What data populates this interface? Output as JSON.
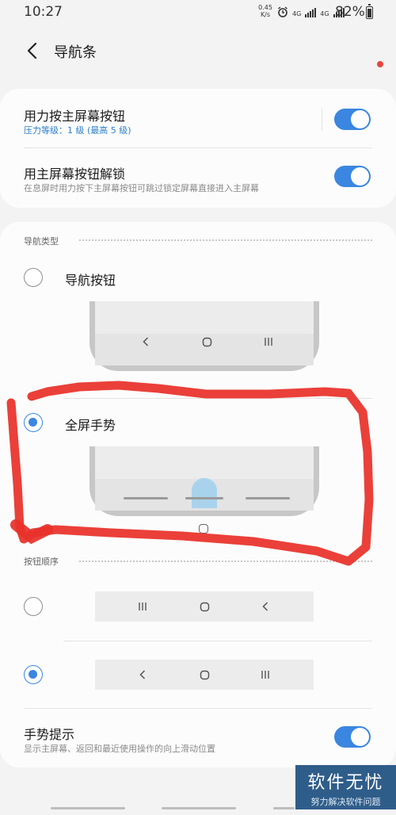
{
  "status": {
    "time": "10:27",
    "net_speed_value": "0.45",
    "net_speed_unit": "K/s",
    "net_type_1": "4G",
    "net_type_2": "4G",
    "battery_percent_text": "82%",
    "battery_level": 0.82
  },
  "header": {
    "title": "导航条",
    "notification_dot_color": "#e8453c"
  },
  "card1": {
    "row1": {
      "title": "用力按主屏幕按钮",
      "subtitle": "压力等级：1 级 (最高 5 级)",
      "toggle_on": true
    },
    "row2": {
      "title": "用主屏幕按钮解锁",
      "subtitle": "在息屏时用力按下主屏幕按钮可跳过锁定屏幕直接进入主屏幕",
      "toggle_on": true
    }
  },
  "nav_type": {
    "section_label": "导航类型",
    "options": [
      {
        "label": "导航按钮",
        "selected": false
      },
      {
        "label": "全屏手势",
        "selected": true
      }
    ]
  },
  "button_order": {
    "section_label": "按钮顺序",
    "options": [
      {
        "order": [
          "recents-icon",
          "home-icon",
          "back-icon"
        ],
        "selected": false
      },
      {
        "order": [
          "back-icon",
          "home-icon",
          "recents-icon"
        ],
        "selected": true
      }
    ]
  },
  "gesture_hint": {
    "title": "手势提示",
    "subtitle": "显示主屏幕、返回和最近使用操作的向上滑动位置",
    "toggle_on": true
  },
  "watermark": {
    "big": "软件无忧",
    "small": "努力解决软件问题"
  },
  "colors": {
    "accent": "#3a86e0",
    "annotation": "#e8322a",
    "background": "#f3f3f3",
    "card": "#fcfcfc"
  }
}
